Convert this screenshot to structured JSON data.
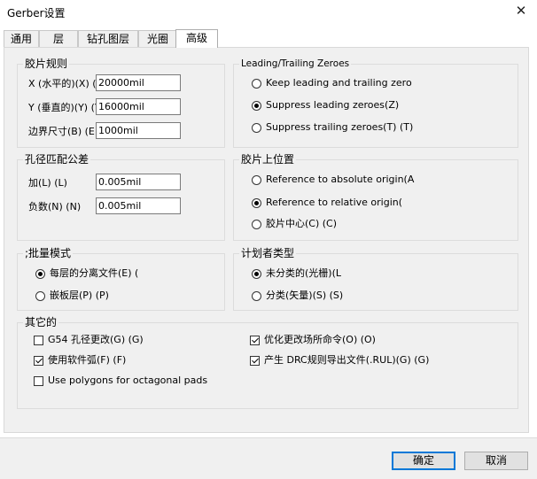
{
  "window": {
    "title": "Gerber设置",
    "close_glyph": "✕"
  },
  "tabs": [
    {
      "label": "通用"
    },
    {
      "label": "层"
    },
    {
      "label": "钻孔图层"
    },
    {
      "label": "光圈"
    },
    {
      "label": "高级",
      "active": true
    }
  ],
  "film_rules": {
    "title": "胶片规则",
    "x_label": "X (水平的)(X) (",
    "x_value": "20000mil",
    "y_label": "Y (垂直的)(Y) (Y",
    "y_value": "16000mil",
    "border_label": "边界尺寸(B) (E",
    "border_value": "1000mil"
  },
  "leading_trailing": {
    "title": "Leading/Trailing Zeroes",
    "options": [
      {
        "label": "Keep leading and trailing zero",
        "selected": false
      },
      {
        "label": "Suppress leading zeroes(Z)",
        "selected": true
      },
      {
        "label": "Suppress trailing zeroes(T) (T)",
        "selected": false
      }
    ]
  },
  "hole_tolerance": {
    "title": "孔径匹配公差",
    "plus_label": "加(L) (L)",
    "plus_value": "0.005mil",
    "minus_label": "负数(N) (N)",
    "minus_value": "0.005mil"
  },
  "film_position": {
    "title": "胶片上位置",
    "options": [
      {
        "label": "Reference to absolute origin(A",
        "selected": false
      },
      {
        "label": "Reference to relative origin(",
        "selected": true
      },
      {
        "label": "胶片中心(C) (C)",
        "selected": false
      }
    ]
  },
  "batch_mode": {
    "title": ";批量模式",
    "options": [
      {
        "label": "每层的分离文件(E) (",
        "selected": true
      },
      {
        "label": "嵌板层(P) (P)",
        "selected": false
      }
    ]
  },
  "plotter_type": {
    "title": "计划者类型",
    "options": [
      {
        "label": "未分类的(光栅)(L",
        "selected": true
      },
      {
        "label": "分类(矢量)(S) (S)",
        "selected": false
      }
    ]
  },
  "other": {
    "title": "其它的",
    "checks": [
      {
        "label": "G54 孔径更改(G) (G)",
        "checked": false
      },
      {
        "label": "优化更改场所命令(O) (O)",
        "checked": true
      },
      {
        "label": "使用软件弧(F) (F)",
        "checked": true
      },
      {
        "label": "产生 DRC规则导出文件(.RUL)(G) (G)",
        "checked": true
      },
      {
        "label": "Use polygons for octagonal pads",
        "checked": false
      }
    ]
  },
  "buttons": {
    "ok": "确定",
    "cancel": "取消"
  },
  "colors": {
    "panel_bg": "#f0f0f0",
    "accent": "#0078d7"
  }
}
